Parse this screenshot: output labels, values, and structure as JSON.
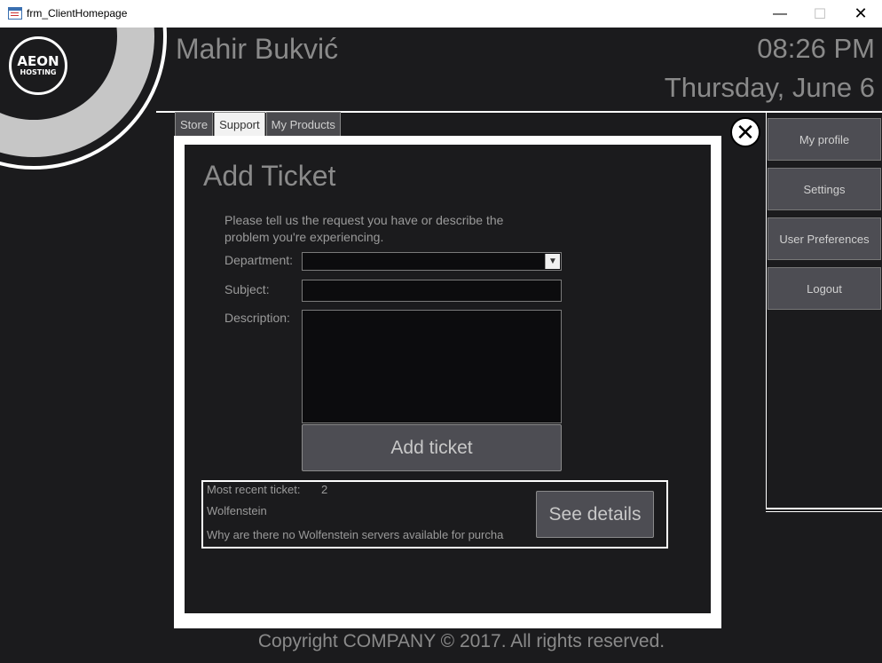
{
  "window": {
    "title": "frm_ClientHomepage"
  },
  "logo": {
    "line1": "AEON",
    "line2": "HOSTING"
  },
  "header": {
    "username": "Mahir Bukvić",
    "time": "08:26 PM",
    "date": "Thursday, June 6"
  },
  "tabs": [
    {
      "label": "Store"
    },
    {
      "label": "Support"
    },
    {
      "label": "My Products"
    }
  ],
  "form": {
    "heading": "Add Ticket",
    "intro": "Please tell us the request you have or describe the problem you're experiencing.",
    "department_label": "Department:",
    "department_value": "",
    "subject_label": "Subject:",
    "subject_value": "",
    "description_label": "Description:",
    "description_value": "",
    "add_button": "Add ticket"
  },
  "recent": {
    "label": "Most recent ticket:",
    "number": "2",
    "subject": "Wolfenstein",
    "description": "Why are there no Wolfenstein servers available for purcha",
    "details_button": "See details"
  },
  "sidebar": {
    "items": [
      {
        "label": "My profile"
      },
      {
        "label": "Settings"
      },
      {
        "label": "User Preferences"
      },
      {
        "label": "Logout"
      }
    ]
  },
  "footer": {
    "text": "Copyright COMPANY © 2017. All rights reserved."
  }
}
